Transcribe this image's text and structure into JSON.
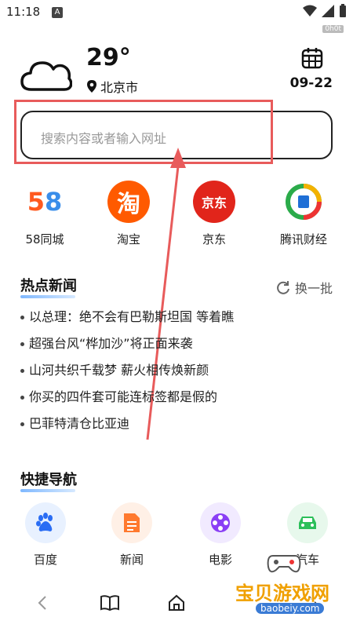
{
  "status": {
    "time": "11:18",
    "a_badge": "A",
    "top_badge": "0h0t"
  },
  "weather": {
    "temperature": "29°",
    "location": "北京市",
    "date": "09-22"
  },
  "search": {
    "placeholder": "搜索内容或者输入网址"
  },
  "apps": [
    {
      "label": "58同城",
      "icon": "58-logo-icon",
      "glyph": "58"
    },
    {
      "label": "淘宝",
      "icon": "taobao-logo-icon",
      "glyph": "淘"
    },
    {
      "label": "京东",
      "icon": "jd-logo-icon",
      "glyph": "京东"
    },
    {
      "label": "腾讯财经",
      "icon": "tencent-finance-logo-icon",
      "glyph": ""
    }
  ],
  "hot_news": {
    "title": "热点新闻",
    "refresh_label": "换一批",
    "items": [
      "以总理：绝不会有巴勒斯坦国 等着瞧",
      "超强台风“桦加沙”将正面来袭",
      "山河共织千载梦 薪火相传焕新颜",
      "你买的四件套可能连标签都是假的",
      "巴菲特清仓比亚迪"
    ]
  },
  "quick_nav": {
    "title": "快捷导航",
    "items": [
      {
        "label": "百度",
        "icon": "baidu-paw-icon"
      },
      {
        "label": "新闻",
        "icon": "news-doc-icon"
      },
      {
        "label": "电影",
        "icon": "film-reel-icon"
      },
      {
        "label": "汽车",
        "icon": "car-icon"
      }
    ]
  },
  "watermark": {
    "text": "宝贝游戏网",
    "url": "baobeiy.com"
  },
  "colors": {
    "highlight": "#e85b5b",
    "taobao": "#ff5a00",
    "jd": "#e1251b",
    "accent_underline": "#7fb8ff"
  }
}
